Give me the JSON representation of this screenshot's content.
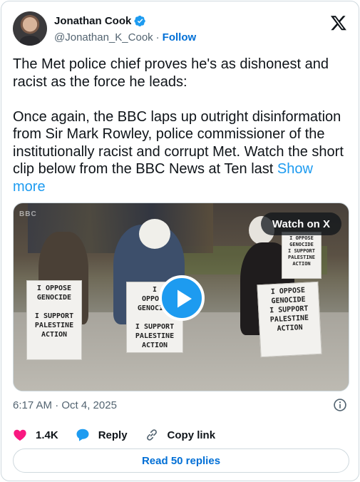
{
  "author": {
    "display_name": "Jonathan Cook",
    "handle": "@Jonathan_K_Cook",
    "separator": "·",
    "follow_label": "Follow",
    "verified": true
  },
  "tweet": {
    "text": "The Met police chief proves he's as dishonest and racist as the force he leads:\n\nOnce again, the BBC laps up outright disinformation from Sir Mark Rowley, police commissioner of the institutionally racist and corrupt Met. Watch the short clip below from the BBC News at Ten last ",
    "show_more": "Show more"
  },
  "media": {
    "watermark": "BBC",
    "watch_label": "Watch on X",
    "signs": {
      "left": "I OPPOSE\nGENOCIDE\n\nI SUPPORT\nPALESTINE\nACTION",
      "middle": "I\nOPPOSE\nGENOCIDE\n\nI SUPPORT\nPALESTINE\nACTION",
      "right": "I OPPOSE\nGENOCIDE\nI SUPPORT\nPALESTINE\nACTION",
      "back": "I OPPOSE\nGENOCIDE\nI SUPPORT\nPALESTINE\nACTION"
    }
  },
  "meta": {
    "timestamp": "6:17 AM · Oct 4, 2025"
  },
  "actions": {
    "likes": "1.4K",
    "reply_label": "Reply",
    "copy_label": "Copy link",
    "read_replies": "Read 50 replies"
  },
  "colors": {
    "accent": "#1d9bf0",
    "link": "#006fd6",
    "like": "#f91880",
    "muted": "#536471"
  },
  "icons": [
    "verified-badge-icon",
    "x-logo-icon",
    "play-icon",
    "info-icon",
    "heart-icon",
    "reply-icon",
    "link-icon"
  ]
}
